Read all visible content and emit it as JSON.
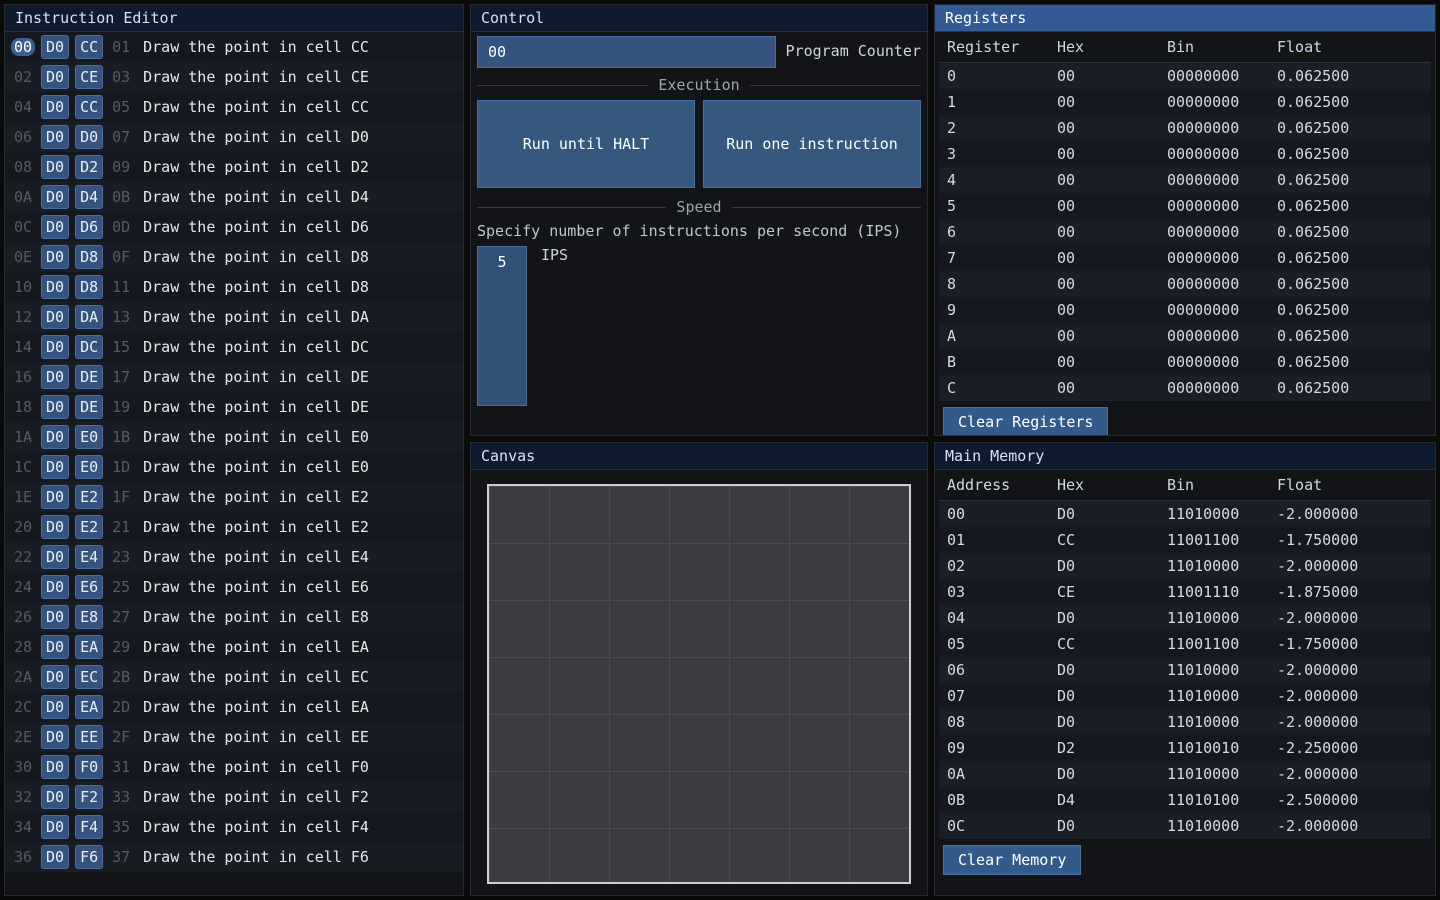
{
  "editor": {
    "title": "Instruction Editor",
    "rows": [
      {
        "addr0": "00",
        "b0": "D0",
        "b1": "CC",
        "addr1": "01",
        "desc": "Draw the point in cell CC",
        "current": true
      },
      {
        "addr0": "02",
        "b0": "D0",
        "b1": "CE",
        "addr1": "03",
        "desc": "Draw the point in cell CE"
      },
      {
        "addr0": "04",
        "b0": "D0",
        "b1": "CC",
        "addr1": "05",
        "desc": "Draw the point in cell CC"
      },
      {
        "addr0": "06",
        "b0": "D0",
        "b1": "D0",
        "addr1": "07",
        "desc": "Draw the point in cell D0"
      },
      {
        "addr0": "08",
        "b0": "D0",
        "b1": "D2",
        "addr1": "09",
        "desc": "Draw the point in cell D2"
      },
      {
        "addr0": "0A",
        "b0": "D0",
        "b1": "D4",
        "addr1": "0B",
        "desc": "Draw the point in cell D4"
      },
      {
        "addr0": "0C",
        "b0": "D0",
        "b1": "D6",
        "addr1": "0D",
        "desc": "Draw the point in cell D6"
      },
      {
        "addr0": "0E",
        "b0": "D0",
        "b1": "D8",
        "addr1": "0F",
        "desc": "Draw the point in cell D8"
      },
      {
        "addr0": "10",
        "b0": "D0",
        "b1": "D8",
        "addr1": "11",
        "desc": "Draw the point in cell D8"
      },
      {
        "addr0": "12",
        "b0": "D0",
        "b1": "DA",
        "addr1": "13",
        "desc": "Draw the point in cell DA"
      },
      {
        "addr0": "14",
        "b0": "D0",
        "b1": "DC",
        "addr1": "15",
        "desc": "Draw the point in cell DC"
      },
      {
        "addr0": "16",
        "b0": "D0",
        "b1": "DE",
        "addr1": "17",
        "desc": "Draw the point in cell DE"
      },
      {
        "addr0": "18",
        "b0": "D0",
        "b1": "DE",
        "addr1": "19",
        "desc": "Draw the point in cell DE"
      },
      {
        "addr0": "1A",
        "b0": "D0",
        "b1": "E0",
        "addr1": "1B",
        "desc": "Draw the point in cell E0"
      },
      {
        "addr0": "1C",
        "b0": "D0",
        "b1": "E0",
        "addr1": "1D",
        "desc": "Draw the point in cell E0"
      },
      {
        "addr0": "1E",
        "b0": "D0",
        "b1": "E2",
        "addr1": "1F",
        "desc": "Draw the point in cell E2"
      },
      {
        "addr0": "20",
        "b0": "D0",
        "b1": "E2",
        "addr1": "21",
        "desc": "Draw the point in cell E2"
      },
      {
        "addr0": "22",
        "b0": "D0",
        "b1": "E4",
        "addr1": "23",
        "desc": "Draw the point in cell E4"
      },
      {
        "addr0": "24",
        "b0": "D0",
        "b1": "E6",
        "addr1": "25",
        "desc": "Draw the point in cell E6"
      },
      {
        "addr0": "26",
        "b0": "D0",
        "b1": "E8",
        "addr1": "27",
        "desc": "Draw the point in cell E8"
      },
      {
        "addr0": "28",
        "b0": "D0",
        "b1": "EA",
        "addr1": "29",
        "desc": "Draw the point in cell EA"
      },
      {
        "addr0": "2A",
        "b0": "D0",
        "b1": "EC",
        "addr1": "2B",
        "desc": "Draw the point in cell EC"
      },
      {
        "addr0": "2C",
        "b0": "D0",
        "b1": "EA",
        "addr1": "2D",
        "desc": "Draw the point in cell EA"
      },
      {
        "addr0": "2E",
        "b0": "D0",
        "b1": "EE",
        "addr1": "2F",
        "desc": "Draw the point in cell EE"
      },
      {
        "addr0": "30",
        "b0": "D0",
        "b1": "F0",
        "addr1": "31",
        "desc": "Draw the point in cell F0"
      },
      {
        "addr0": "32",
        "b0": "D0",
        "b1": "F2",
        "addr1": "33",
        "desc": "Draw the point in cell F2"
      },
      {
        "addr0": "34",
        "b0": "D0",
        "b1": "F4",
        "addr1": "35",
        "desc": "Draw the point in cell F4"
      },
      {
        "addr0": "36",
        "b0": "D0",
        "b1": "F6",
        "addr1": "37",
        "desc": "Draw the point in cell F6"
      }
    ]
  },
  "control": {
    "title": "Control",
    "pc_value": "00",
    "pc_label": "Program Counter",
    "execution_legend": "Execution",
    "run_label": "Run until HALT",
    "step_label": "Run one instruction",
    "speed_legend": "Speed",
    "speed_desc": "Specify number of instructions per second (IPS)",
    "ips_value": "5",
    "ips_label": "IPS"
  },
  "registers": {
    "title": "Registers",
    "cols": [
      "Register",
      "Hex",
      "Bin",
      "Float"
    ],
    "rows": [
      {
        "r": "0",
        "hex": "00",
        "bin": "00000000",
        "flt": "0.062500"
      },
      {
        "r": "1",
        "hex": "00",
        "bin": "00000000",
        "flt": "0.062500"
      },
      {
        "r": "2",
        "hex": "00",
        "bin": "00000000",
        "flt": "0.062500"
      },
      {
        "r": "3",
        "hex": "00",
        "bin": "00000000",
        "flt": "0.062500"
      },
      {
        "r": "4",
        "hex": "00",
        "bin": "00000000",
        "flt": "0.062500"
      },
      {
        "r": "5",
        "hex": "00",
        "bin": "00000000",
        "flt": "0.062500"
      },
      {
        "r": "6",
        "hex": "00",
        "bin": "00000000",
        "flt": "0.062500"
      },
      {
        "r": "7",
        "hex": "00",
        "bin": "00000000",
        "flt": "0.062500"
      },
      {
        "r": "8",
        "hex": "00",
        "bin": "00000000",
        "flt": "0.062500"
      },
      {
        "r": "9",
        "hex": "00",
        "bin": "00000000",
        "flt": "0.062500"
      },
      {
        "r": "A",
        "hex": "00",
        "bin": "00000000",
        "flt": "0.062500"
      },
      {
        "r": "B",
        "hex": "00",
        "bin": "00000000",
        "flt": "0.062500"
      },
      {
        "r": "C",
        "hex": "00",
        "bin": "00000000",
        "flt": "0.062500"
      }
    ],
    "clear_label": "Clear Registers"
  },
  "canvas": {
    "title": "Canvas"
  },
  "memory": {
    "title": "Main Memory",
    "cols": [
      "Address",
      "Hex",
      "Bin",
      "Float"
    ],
    "rows": [
      {
        "a": "00",
        "hex": "D0",
        "bin": "11010000",
        "flt": "-2.000000"
      },
      {
        "a": "01",
        "hex": "CC",
        "bin": "11001100",
        "flt": "-1.750000"
      },
      {
        "a": "02",
        "hex": "D0",
        "bin": "11010000",
        "flt": "-2.000000"
      },
      {
        "a": "03",
        "hex": "CE",
        "bin": "11001110",
        "flt": "-1.875000"
      },
      {
        "a": "04",
        "hex": "D0",
        "bin": "11010000",
        "flt": "-2.000000"
      },
      {
        "a": "05",
        "hex": "CC",
        "bin": "11001100",
        "flt": "-1.750000"
      },
      {
        "a": "06",
        "hex": "D0",
        "bin": "11010000",
        "flt": "-2.000000"
      },
      {
        "a": "07",
        "hex": "D0",
        "bin": "11010000",
        "flt": "-2.000000"
      },
      {
        "a": "08",
        "hex": "D0",
        "bin": "11010000",
        "flt": "-2.000000"
      },
      {
        "a": "09",
        "hex": "D2",
        "bin": "11010010",
        "flt": "-2.250000"
      },
      {
        "a": "0A",
        "hex": "D0",
        "bin": "11010000",
        "flt": "-2.000000"
      },
      {
        "a": "0B",
        "hex": "D4",
        "bin": "11010100",
        "flt": "-2.500000"
      },
      {
        "a": "0C",
        "hex": "D0",
        "bin": "11010000",
        "flt": "-2.000000"
      }
    ],
    "clear_label": "Clear Memory"
  }
}
